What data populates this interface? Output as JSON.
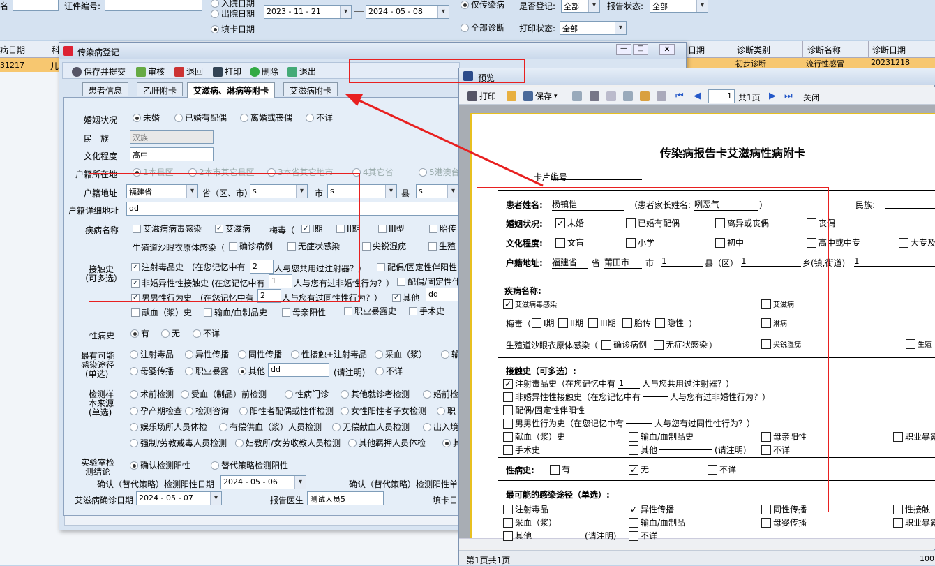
{
  "top": {
    "name_label": "名",
    "id_label": "证件编号:",
    "date_types": [
      "入院日期",
      "出院日期",
      "填卡日期"
    ],
    "date_start": "2023 - 11 - 21",
    "date_end": "2024 - 05 - 08",
    "scope": [
      "仅传染病",
      "全部诊断"
    ],
    "register_label": "是否登记:",
    "register_value": "全部",
    "report_status_label": "报告状态:",
    "report_status_value": "全部",
    "print_status_label": "打印状态:",
    "print_status_value": "全部"
  },
  "bg_grid": {
    "left_header": "病日期",
    "left_header2": "科",
    "left_cell": "31217",
    "left_cell2": "儿",
    "right_headers": [
      "日期",
      "诊断类别",
      "诊断名称",
      "诊断日期"
    ],
    "right_row": [
      "",
      "初步诊断",
      "流行性感冒",
      "20231218"
    ]
  },
  "dialog": {
    "title": "传染病登记",
    "toolbar": {
      "save_submit": "保存并提交",
      "audit": "审核",
      "return": "退回",
      "print": "打印",
      "delete": "删除",
      "exit": "退出"
    },
    "tabs": [
      "患者信息",
      "乙肝附卡",
      "艾滋病、淋病等附卡",
      "艾滋病附卡"
    ],
    "marital_label": "婚姻状况",
    "marital_options": [
      "未婚",
      "已婚有配偶",
      "离婚或丧偶",
      "不详"
    ],
    "ethnic_label": "民　族",
    "ethnic_value": "汉族",
    "edu_label": "文化程度",
    "edu_value": "高中",
    "hukou_label": "户籍所在地",
    "hukou_options": [
      "1本县区",
      "2本市其它县区",
      "3本省其它地市",
      "4其它省",
      "5港澳台"
    ],
    "addr_label": "户籍地址",
    "addr_province": "福建省",
    "addr_province_suffix": "省（区、市）",
    "addr_city": "s",
    "addr_city_suffix": "市",
    "addr_county": "s",
    "addr_county_suffix": "县",
    "addr_town": "s",
    "addr_detail_label": "户籍详细地址",
    "addr_detail_value": "dd",
    "disease_label": "疾病名称",
    "disease_row1": [
      "艾滋病病毒感染",
      "艾滋病",
      "梅毒（",
      "I期",
      "II期",
      "III型",
      "胎传"
    ],
    "disease_row2_prefix": "生殖道沙眼衣原体感染（",
    "disease_row2": [
      "确诊病例",
      "无症状感染",
      "尖锐湿疣",
      "生殖"
    ],
    "contact_label": "接触史",
    "contact_sub": "（可多选）",
    "contact_1a": "注射毒品史　(在您记忆中有",
    "contact_1v": "2",
    "contact_1b": "人与您共用过注射器？）",
    "contact_1c": "配偶/固定性伴阳性",
    "contact_2a": "非婚异性性接触史 (在您记忆中有",
    "contact_2v": "1",
    "contact_2b": "人与您有过非婚性行为？）",
    "contact_2c": "配偶/固定性伴",
    "contact_3a": "男男性行为史　(在您记忆中有",
    "contact_3v": "2",
    "contact_3b": "人与您有过同性性行为？）",
    "contact_3c": "其他",
    "contact_3d": "dd",
    "contact_row4": [
      "献血（浆）史",
      "输血/血制品史",
      "母亲阳性",
      "职业暴露史",
      "手术史"
    ],
    "std_label": "性病史",
    "std_options": [
      "有",
      "无",
      "不详"
    ],
    "route_label1": "最有可能",
    "route_label2": "感染途径",
    "route_label3": "(单选)",
    "route_row1": [
      "注射毒品",
      "异性传播",
      "同性传播",
      "性接触+注射毒品",
      "采血（浆）",
      "输"
    ],
    "route_row2": [
      "母婴传播",
      "职业暴露",
      "其他"
    ],
    "route_other_value": "dd",
    "route_note": "(请注明)",
    "route_unknown": "不详",
    "sample_label1": "检测样",
    "sample_label2": "本来源",
    "sample_label3": "(单选)",
    "sample_row1": [
      "术前检测",
      "受血（制品）前检测",
      "性病门诊",
      "其他就诊者检测",
      "婚前检"
    ],
    "sample_row2": [
      "孕产期检查",
      "检测咨询",
      "阳性者配偶或性伴检测",
      "女性阳性者子女检测",
      "职"
    ],
    "sample_row3": [
      "娱乐场所人员体检",
      "有偿供血（浆）人员检测",
      "无偿献血人员检测",
      "出入境"
    ],
    "sample_row4": [
      "强制/劳教戒毒人员检测",
      "妇教所/女劳收教人员检测",
      "其他羁押人员体检",
      "其"
    ],
    "lab_label1": "实验室检",
    "lab_label2": "测结论",
    "lab_options": [
      "确认检测阳性",
      "替代策略检测阳性"
    ],
    "confirm_date_label": "确认（替代策略）检测阳性日期",
    "confirm_date_value": "2024 - 05 - 06",
    "confirm_unit_label": "确认（替代策略）检测阳性单",
    "aids_date_label": "艾滋病确诊日期",
    "aids_date_value": "2024 - 05 - 07",
    "doctor_label": "报告医生",
    "doctor_value": "测试人员5",
    "fill_date_label": "填卡日"
  },
  "preview": {
    "title": "预览",
    "toolbar": {
      "print": "打印",
      "save": "保存",
      "page_value": "1",
      "page_total": "共1页",
      "close": "关闭"
    },
    "status": "第1页共1页",
    "zoom": "100",
    "doc": {
      "title": "传染病报告卡艾滋病性病附卡",
      "card_no_label": "卡片编号",
      "card_no_value": "3",
      "patient_label": "患者姓名:",
      "patient_value": "杨镇恺",
      "parent_label": "（患者家长姓名:",
      "parent_value": "咧恶气",
      "parent_close": "）",
      "ethnic_label": "民族:",
      "marital_label": "婚姻状况:",
      "marital_options": [
        "未婚",
        "已婚有配偶",
        "离异或丧偶",
        "丧偶"
      ],
      "edu_label": "文化程度:",
      "edu_options": [
        "文盲",
        "小学",
        "初中",
        "高中或中专",
        "大专及"
      ],
      "addr_label": "户籍地址:",
      "addr_province": "福建省",
      "addr_province_s": "省",
      "addr_city": "莆田市",
      "addr_city_s": "市",
      "addr_county": "1",
      "addr_county_s": "县（区）",
      "addr_town": "1",
      "addr_town_s": "乡(镇,街道)",
      "addr_village": "1",
      "disease_label": "疾病名称:",
      "disease_row1": [
        "艾滋病毒感染",
        "艾滋病"
      ],
      "syphilis_prefix": "梅毒（",
      "syphilis_opts": [
        "I期",
        "II期",
        "III期",
        "胎传",
        "隐性"
      ],
      "syphilis_close": "）",
      "gonorrhea": "淋病",
      "chlamydia_prefix": "生殖道沙眼衣原体感染（",
      "chlamydia_opts": [
        "确诊病例",
        "无症状感染"
      ],
      "chlamydia_close": "）",
      "condyloma": "尖锐湿疣",
      "genital": "生殖",
      "contact_label": "接触史（可多选）:",
      "c1a": "注射毒品史（在您记忆中有",
      "c1v": "1",
      "c1b": "人与您共用过注射器？）",
      "c2a": "非婚异性性接触史（在您记忆中有",
      "c2b": "人与您有过非婚性行为？）",
      "c3": "配偶/固定性伴阳性",
      "c4a": "男男性行为史（在您记忆中有",
      "c4b": "人与您有过同性性行为？）",
      "c5": [
        "献血（浆）史",
        "输血/血制品史",
        "母亲阳性",
        "职业暴露"
      ],
      "c6a": "手术史",
      "c6b": "其他",
      "c6note": "(请注明)",
      "c6c": "不详",
      "std_label": "性病史:",
      "std_options": [
        "有",
        "无",
        "不详"
      ],
      "route_label": "最可能的感染途径（单选）:",
      "route_row1": [
        "注射毒品",
        "异性传播",
        "同性传播",
        "性接触"
      ],
      "route_row2": [
        "采血（浆）",
        "输血/血制品",
        "母婴传播",
        "职业暴露"
      ],
      "route_row3a": "其他",
      "route_row3note": "(请注明)",
      "route_row3b": "不详"
    }
  },
  "colors": {
    "annotation_red": "#e82020",
    "selection_orange": "#f7c770"
  }
}
